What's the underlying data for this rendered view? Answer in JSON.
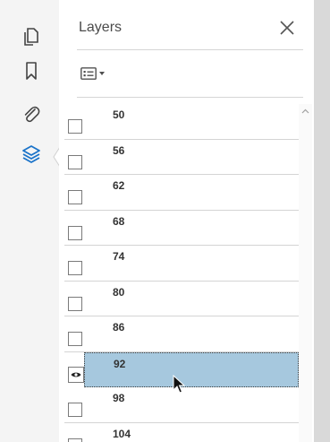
{
  "panel": {
    "title": "Layers"
  },
  "rail": {
    "items": [
      {
        "name": "page-thumbnails",
        "icon": "pages-icon",
        "active": false
      },
      {
        "name": "bookmarks",
        "icon": "bookmark-icon",
        "active": false
      },
      {
        "name": "attachments",
        "icon": "paperclip-icon",
        "active": false
      },
      {
        "name": "layers",
        "icon": "layers-icon",
        "active": true
      }
    ]
  },
  "toolbar": {
    "options_icon": "list-options-icon"
  },
  "layers": [
    {
      "label": "50",
      "visible": false,
      "selected": false
    },
    {
      "label": "56",
      "visible": false,
      "selected": false
    },
    {
      "label": "62",
      "visible": false,
      "selected": false
    },
    {
      "label": "68",
      "visible": false,
      "selected": false
    },
    {
      "label": "74",
      "visible": false,
      "selected": false
    },
    {
      "label": "80",
      "visible": false,
      "selected": false
    },
    {
      "label": "86",
      "visible": false,
      "selected": false
    },
    {
      "label": "92",
      "visible": true,
      "selected": true
    },
    {
      "label": "98",
      "visible": false,
      "selected": false
    },
    {
      "label": "104",
      "visible": false,
      "selected": false
    }
  ],
  "colors": {
    "accent": "#1a73c9",
    "selection": "#a6c8de",
    "rail_bg": "#f4f4f4"
  }
}
